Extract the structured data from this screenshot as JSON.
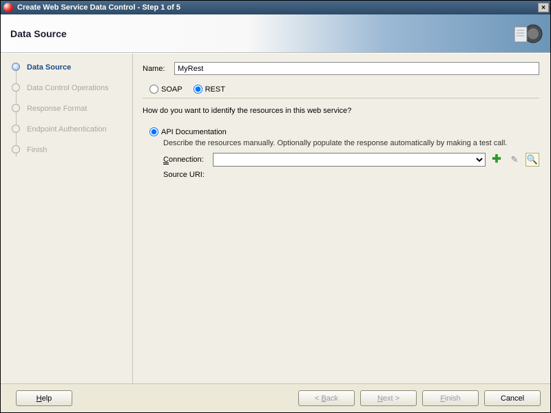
{
  "window": {
    "title": "Create Web Service Data Control - Step 1 of 5",
    "close": "×"
  },
  "header": {
    "title": "Data Source"
  },
  "steps": [
    {
      "label": "Data Source",
      "active": true
    },
    {
      "label": "Data Control Operations",
      "active": false
    },
    {
      "label": "Response Format",
      "active": false
    },
    {
      "label": "Endpoint Authentication",
      "active": false
    },
    {
      "label": "Finish",
      "active": false
    }
  ],
  "form": {
    "name_label": "Name:",
    "name_value": "MyRest",
    "protocol": {
      "soap": {
        "label": "SOAP",
        "selected": false
      },
      "rest": {
        "label": "REST",
        "selected": true
      }
    },
    "question": "How do you want to identify the resources in this web service?",
    "api_doc": {
      "label": "API Documentation",
      "selected": true,
      "description": "Describe the resources manually. Optionally populate the response automatically by making a test call.",
      "connection_label": "Connection:",
      "connection_value": "",
      "source_uri_label": "Source URI:",
      "source_uri_value": ""
    }
  },
  "icons": {
    "add": "add-icon",
    "edit": "edit-icon",
    "browse": "browse-icon"
  },
  "footer": {
    "help": "Help",
    "back": "< Back",
    "next": "Next >",
    "finish": "Finish",
    "cancel": "Cancel"
  }
}
